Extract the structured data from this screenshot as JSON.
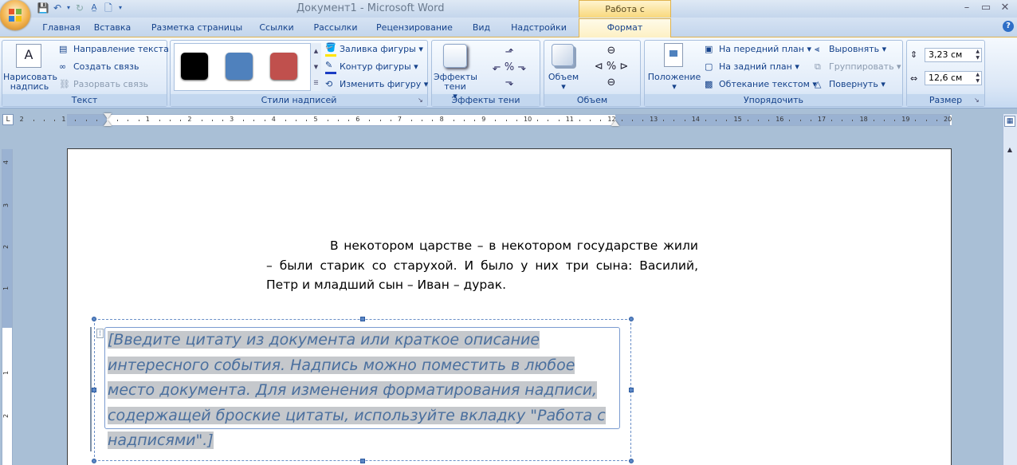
{
  "window": {
    "title": "Документ1 - Microsoft Word",
    "context_tab": "Работа с надписями"
  },
  "tabs": [
    {
      "label": "Главная"
    },
    {
      "label": "Вставка"
    },
    {
      "label": "Разметка страницы"
    },
    {
      "label": "Ссылки"
    },
    {
      "label": "Рассылки"
    },
    {
      "label": "Рецензирование"
    },
    {
      "label": "Вид"
    },
    {
      "label": "Надстройки"
    },
    {
      "label": "Формат"
    }
  ],
  "ribbon": {
    "text_group": {
      "label": "Текст",
      "draw_textbox": "Нарисовать надпись",
      "text_direction": "Направление текста",
      "create_link": "Создать связь",
      "break_link": "Разорвать связь"
    },
    "styles_group": {
      "label": "Стили надписей",
      "swatches": [
        "#000000",
        "#4f81bd",
        "#c0504d"
      ],
      "shape_fill": "Заливка фигуры",
      "shape_outline": "Контур фигуры",
      "change_shape": "Изменить фигуру"
    },
    "shadow_group": {
      "label": "Эффекты тени",
      "shadow_effects": "Эффекты тени"
    },
    "volume_group": {
      "label": "Объем",
      "volume": "Объем"
    },
    "arrange_group": {
      "label": "Упорядочить",
      "position": "Положение",
      "bring_front": "На передний план",
      "send_back": "На задний план",
      "text_wrap": "Обтекание текстом",
      "align": "Выровнять",
      "group": "Группировать",
      "rotate": "Повернуть"
    },
    "size_group": {
      "label": "Размер",
      "height": "3,23 см",
      "width": "12,6 см"
    }
  },
  "ruler": {
    "numbers": [
      "2",
      "1",
      "1",
      "2",
      "3",
      "4",
      "5",
      "6",
      "7",
      "8",
      "9",
      "10",
      "11",
      "12",
      "13",
      "14",
      "15",
      "16",
      "17",
      "18",
      "19",
      "20"
    ],
    "vnumbers": [
      "4",
      "3",
      "2",
      "1",
      "1",
      "2"
    ]
  },
  "document": {
    "paragraph": "В некотором царстве – в некотором государстве жили – были старик со старухой. И было у них три сына: Василий, Петр и младший сын – Иван – дурак.",
    "textbox_lines": [
      "[Введите цитату из документа или краткое описание",
      "интересного события. Надпись можно поместить в любое",
      "место документа. Для изменения форматирования надписи,",
      "содержащей броские цитаты, используйте вкладку \"Работа с",
      "надписями\".]"
    ]
  }
}
